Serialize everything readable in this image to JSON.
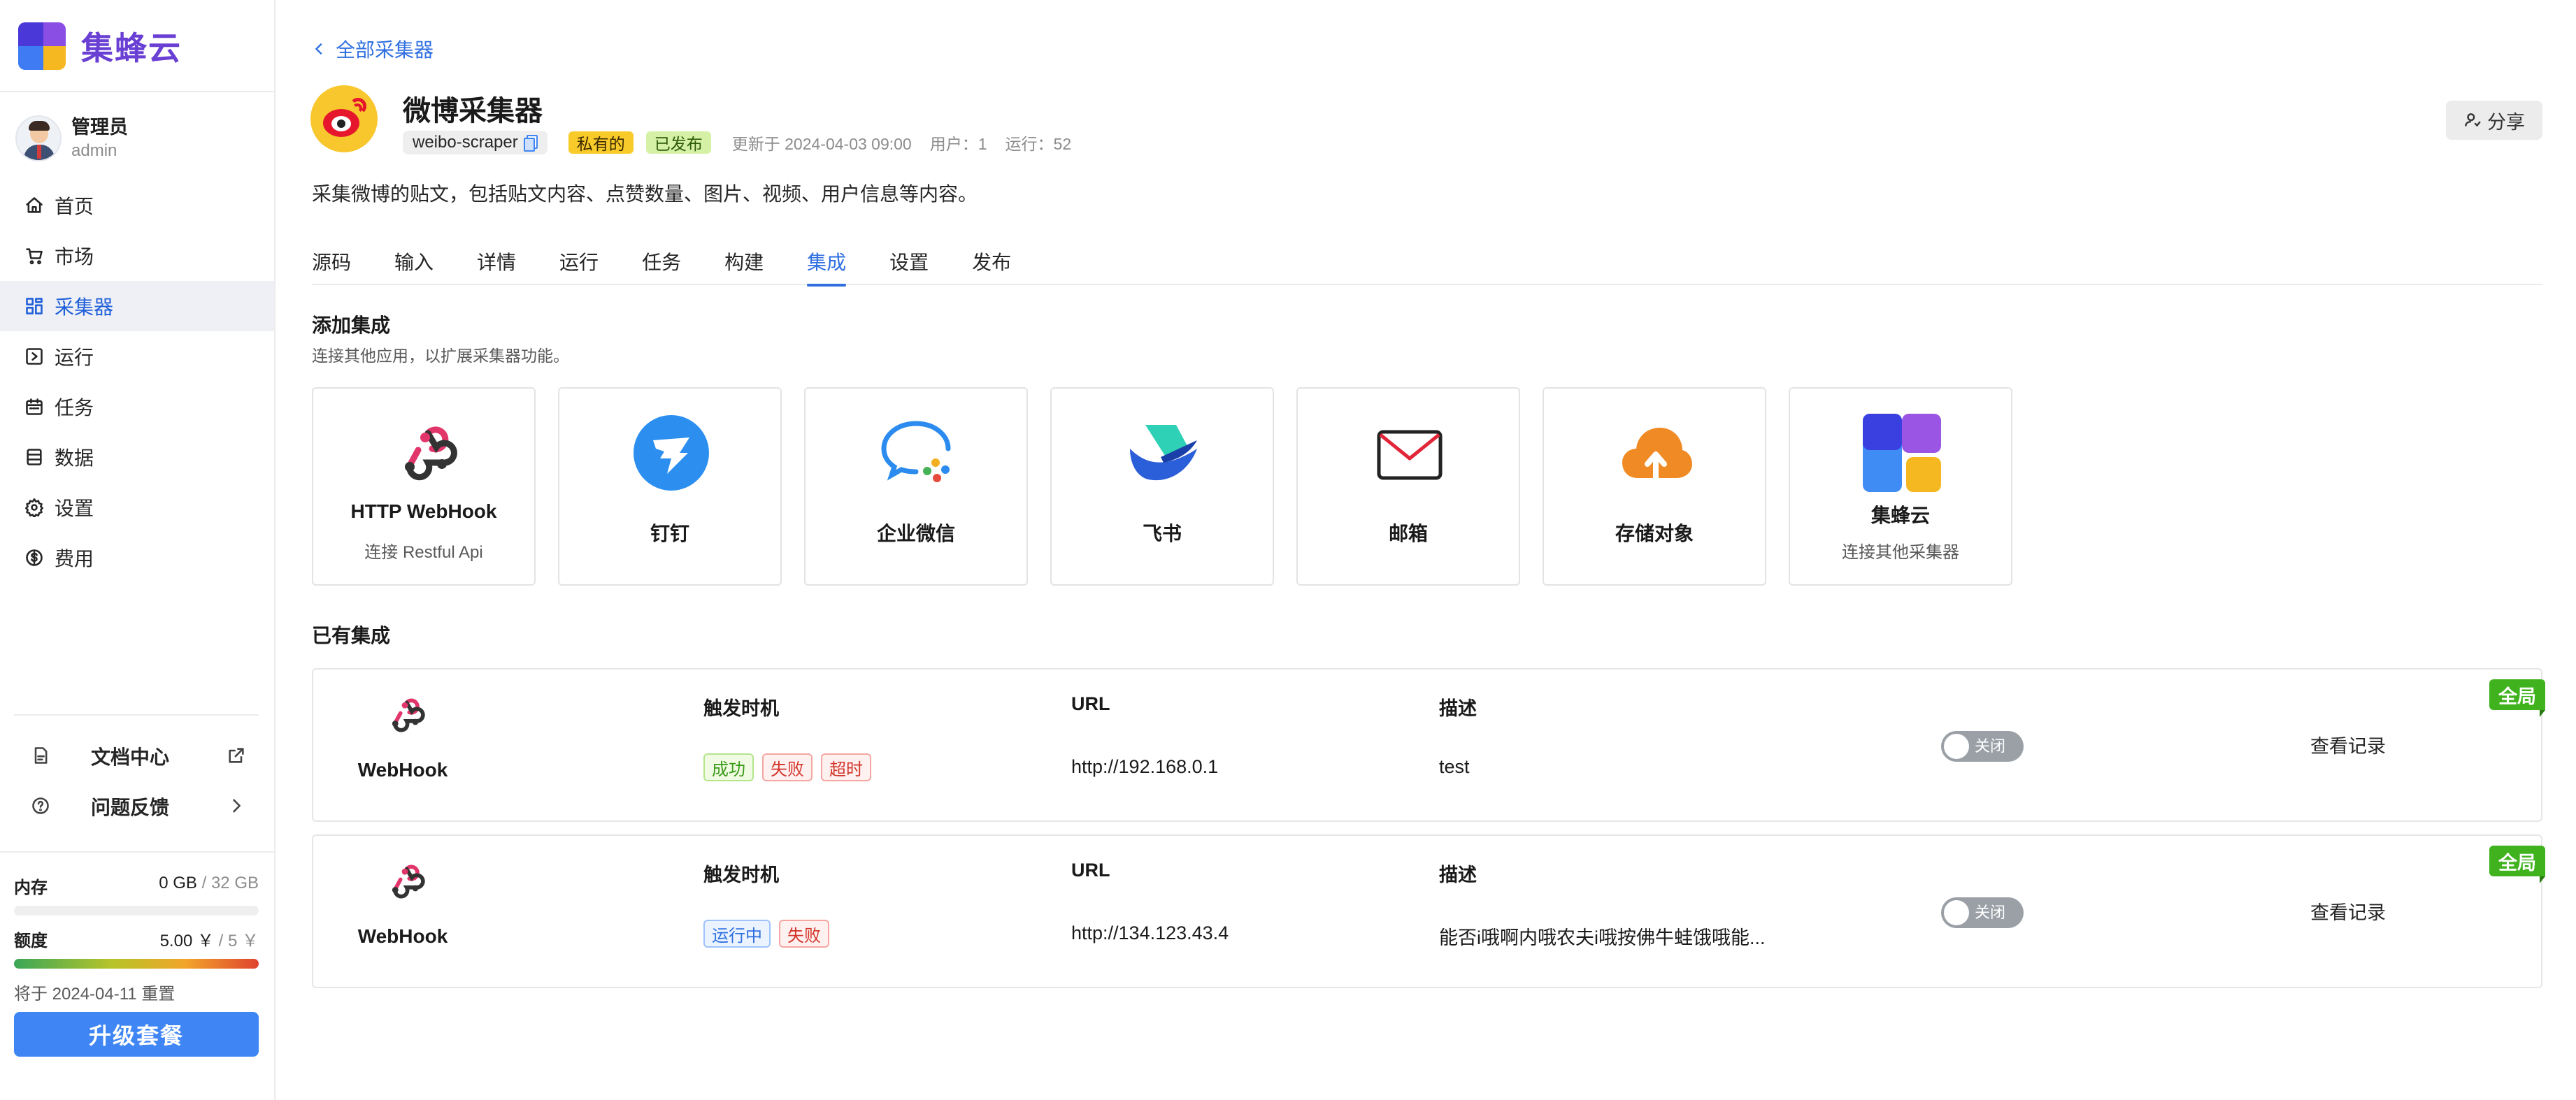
{
  "brand": {
    "name": "集蜂云"
  },
  "user": {
    "name": "管理员",
    "id": "admin"
  },
  "nav": [
    {
      "label": "首页",
      "icon": "home-icon"
    },
    {
      "label": "市场",
      "icon": "cart-icon"
    },
    {
      "label": "采集器",
      "icon": "grid-icon",
      "active": true
    },
    {
      "label": "运行",
      "icon": "run-icon"
    },
    {
      "label": "任务",
      "icon": "calendar-icon"
    },
    {
      "label": "数据",
      "icon": "database-icon"
    },
    {
      "label": "设置",
      "icon": "gear-icon"
    },
    {
      "label": "费用",
      "icon": "dollar-icon"
    }
  ],
  "side_links": {
    "docs": "文档中心",
    "feedback": "问题反馈"
  },
  "resources": {
    "memory_label": "内存",
    "memory_used": "0 GB",
    "memory_total": "/ 32 GB",
    "memory_fraction": 0,
    "quota_label": "额度",
    "quota_used": "5.00 ￥",
    "quota_total": "/ 5 ￥",
    "quota_fraction": 1,
    "reset_note": "将于 2024-04-11 重置",
    "upgrade_label": "升级套餐"
  },
  "header": {
    "back_label": "全部采集器",
    "title": "微博采集器",
    "slug": "weibo-scraper",
    "tag_private": "私有的",
    "tag_published": "已发布",
    "updated": "更新于 2024-04-03 09:00",
    "users": "用户：1",
    "runs": "运行：52",
    "share_label": "分享",
    "description": "采集微博的贴文，包括贴文内容、点赞数量、图片、视频、用户信息等内容。"
  },
  "tabs": [
    "源码",
    "输入",
    "详情",
    "运行",
    "任务",
    "构建",
    "集成",
    "设置",
    "发布"
  ],
  "active_tab": "集成",
  "add_section": {
    "title": "添加集成",
    "subtitle": "连接其他应用，以扩展采集器功能。",
    "cards": [
      {
        "name": "HTTP WebHook",
        "sub": "连接 Restful Api",
        "icon": "webhook-icon"
      },
      {
        "name": "钉钉",
        "sub": "",
        "icon": "dingtalk-icon"
      },
      {
        "name": "企业微信",
        "sub": "",
        "icon": "wecom-icon"
      },
      {
        "name": "飞书",
        "sub": "",
        "icon": "feishu-icon"
      },
      {
        "name": "邮箱",
        "sub": "",
        "icon": "mail-icon"
      },
      {
        "name": "存储对象",
        "sub": "",
        "icon": "cloud-storage-icon"
      },
      {
        "name": "集蜂云",
        "sub": "连接其他采集器",
        "icon": "jifengyun-icon"
      }
    ]
  },
  "existing_section": {
    "title": "已有集成",
    "col_trigger": "触发时机",
    "col_url": "URL",
    "col_desc": "描述",
    "toggle_off_label": "关闭",
    "view_log_label": "查看记录",
    "global_label": "全局",
    "items": [
      {
        "name": "WebHook",
        "triggers": [
          {
            "label": "成功",
            "color": "green"
          },
          {
            "label": "失败",
            "color": "red"
          },
          {
            "label": "超时",
            "color": "red"
          }
        ],
        "url": "http://192.168.0.1",
        "desc": "test"
      },
      {
        "name": "WebHook",
        "triggers": [
          {
            "label": "运行中",
            "color": "blue"
          },
          {
            "label": "失败",
            "color": "red"
          }
        ],
        "url": "http://134.123.43.4",
        "desc": "能否i哦啊内哦农夫i哦按佛牛蛙饿哦能..."
      }
    ]
  },
  "colors": {
    "accent": "#2f6fe0",
    "brand_purple": "#6a3fd4",
    "upgrade": "#3f86f4",
    "global_badge": "#3fb21d"
  }
}
